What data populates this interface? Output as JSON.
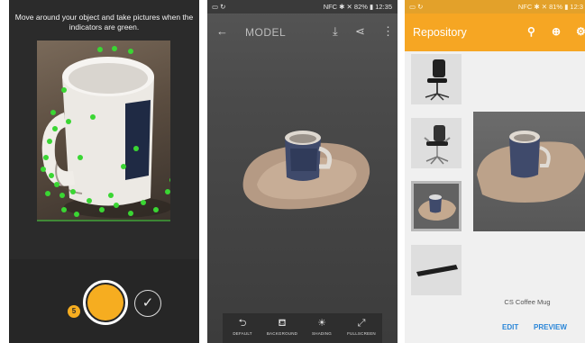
{
  "capture": {
    "instruction": "Move around your object and take pictures when the indicators are green.",
    "photo_count": "5",
    "confirm_icon": "checkmark-icon",
    "shutter_color": "#f6ad20"
  },
  "viewer": {
    "status": {
      "left": "▭ ↻",
      "right": "NFC ✱ ✕ 82% ▮ 12:35"
    },
    "title": "MODEL",
    "icons": [
      "back-arrow-icon",
      "download-icon",
      "share-icon",
      "more-vertical-icon"
    ],
    "buttons": [
      {
        "icon": "undo-icon",
        "label": "DEFAULT"
      },
      {
        "icon": "paint-icon",
        "label": "BACKGROUND"
      },
      {
        "icon": "lightbulb-icon",
        "label": "SHADING"
      },
      {
        "icon": "fullscreen-icon",
        "label": "FULLSCREEN"
      }
    ]
  },
  "repository": {
    "status": {
      "left": "▭ ↻",
      "right": "NFC ✱ ✕ 81% ▮ 12:3"
    },
    "title": "Repository",
    "accent": "#f6a623",
    "icons": [
      "search-icon",
      "add-circle-icon",
      "settings-icon"
    ],
    "items": [
      "office-chair-black",
      "office-chair-armrest",
      "coffee-mug-scan",
      "keyboard"
    ],
    "selected_name": "CS Coffee Mug",
    "edit_label": "EDIT",
    "preview_label": "PREVIEW",
    "link_color": "#2a86d8"
  }
}
